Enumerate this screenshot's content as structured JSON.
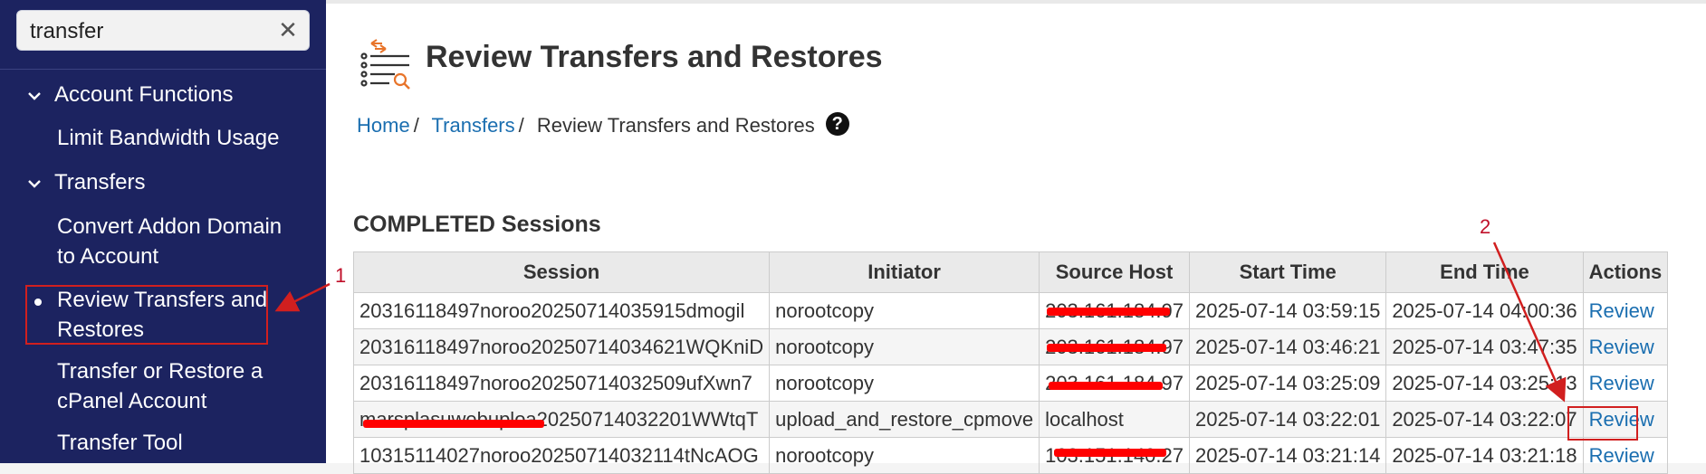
{
  "search": {
    "value": "transfer"
  },
  "sidebar": {
    "sections": [
      {
        "label": "Account Functions",
        "items": [
          {
            "label": "Limit Bandwidth Usage"
          }
        ]
      },
      {
        "label": "Transfers",
        "items": [
          {
            "label_line1": "Convert Addon Domain",
            "label_line2": "to Account"
          },
          {
            "label_line1": "Review Transfers and",
            "label_line2": "Restores",
            "active": true
          },
          {
            "label_line1": "Transfer or Restore a",
            "label_line2": "cPanel Account"
          },
          {
            "label_line1": "Transfer Tool"
          }
        ]
      }
    ]
  },
  "page": {
    "title": "Review Transfers and Restores",
    "breadcrumb": {
      "home": "Home",
      "transfers": "Transfers",
      "current": "Review Transfers and Restores"
    },
    "help": "?"
  },
  "completed": {
    "title": "COMPLETED Sessions",
    "columns": [
      "Session",
      "Initiator",
      "Source Host",
      "Start Time",
      "End Time",
      "Actions"
    ],
    "rows": [
      {
        "session": "20316118497noroo20250714035915dmogil",
        "initiator": "norootcopy",
        "host": "203.161.184.97",
        "start": "2025-07-14 03:59:15",
        "end": "2025-07-14 04:00:36",
        "action": "Review"
      },
      {
        "session": "20316118497noroo20250714034621WQKniD",
        "initiator": "norootcopy",
        "host": "203.161.184.97",
        "start": "2025-07-14 03:46:21",
        "end": "2025-07-14 03:47:35",
        "action": "Review"
      },
      {
        "session": "20316118497noroo20250714032509ufXwn7",
        "initiator": "norootcopy",
        "host": "203.161.184.97",
        "start": "2025-07-14 03:25:09",
        "end": "2025-07-14 03:25:13",
        "action": "Review"
      },
      {
        "session": "marsplasuwebuploa20250714032201WWtqT",
        "initiator": "upload_and_restore_cpmove",
        "host": "localhost",
        "start": "2025-07-14 03:22:01",
        "end": "2025-07-14 03:22:07",
        "action": "Review"
      },
      {
        "session": "10315114027noroo20250714032114tNcAOG",
        "initiator": "norootcopy",
        "host": "103.151.140.27",
        "start": "2025-07-14 03:21:14",
        "end": "2025-07-14 03:21:18",
        "action": "Review"
      }
    ]
  },
  "annotations": {
    "one": "1",
    "two": "2"
  },
  "colors": {
    "sidebar": "#1c2360",
    "link": "#1a6eb0",
    "annotation": "#d11f1f",
    "redaction": "#ff0000"
  }
}
